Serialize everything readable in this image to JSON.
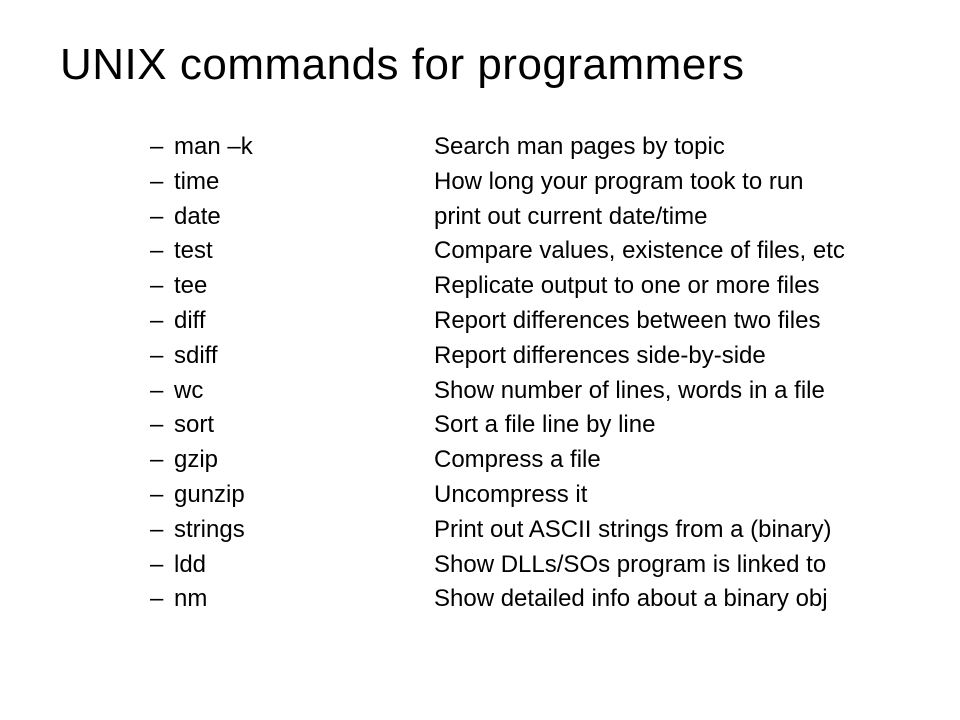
{
  "title": "UNIX commands for programmers",
  "dash": "–",
  "items": [
    {
      "cmd": "man –k",
      "desc": "Search man pages by topic"
    },
    {
      "cmd": "time",
      "desc": "How long your program took to run"
    },
    {
      "cmd": "date",
      "desc": "print out current date/time"
    },
    {
      "cmd": "test",
      "desc": "Compare values, existence of files, etc"
    },
    {
      "cmd": "tee",
      "desc": "Replicate output to one or more files"
    },
    {
      "cmd": "diff",
      "desc": "Report differences between two files"
    },
    {
      "cmd": "sdiff",
      "desc": "Report differences side-by-side"
    },
    {
      "cmd": "wc",
      "desc": "Show number of lines, words in a file"
    },
    {
      "cmd": "sort",
      "desc": "Sort a file line by line"
    },
    {
      "cmd": "gzip",
      "desc": "Compress a file"
    },
    {
      "cmd": "gunzip",
      "desc": "Uncompress it"
    },
    {
      "cmd": "strings",
      "desc": "Print out ASCII strings from a (binary)"
    },
    {
      "cmd": "ldd",
      "desc": "Show DLLs/SOs program is linked to"
    },
    {
      "cmd": "nm",
      "desc": "Show detailed info about a binary obj"
    }
  ]
}
